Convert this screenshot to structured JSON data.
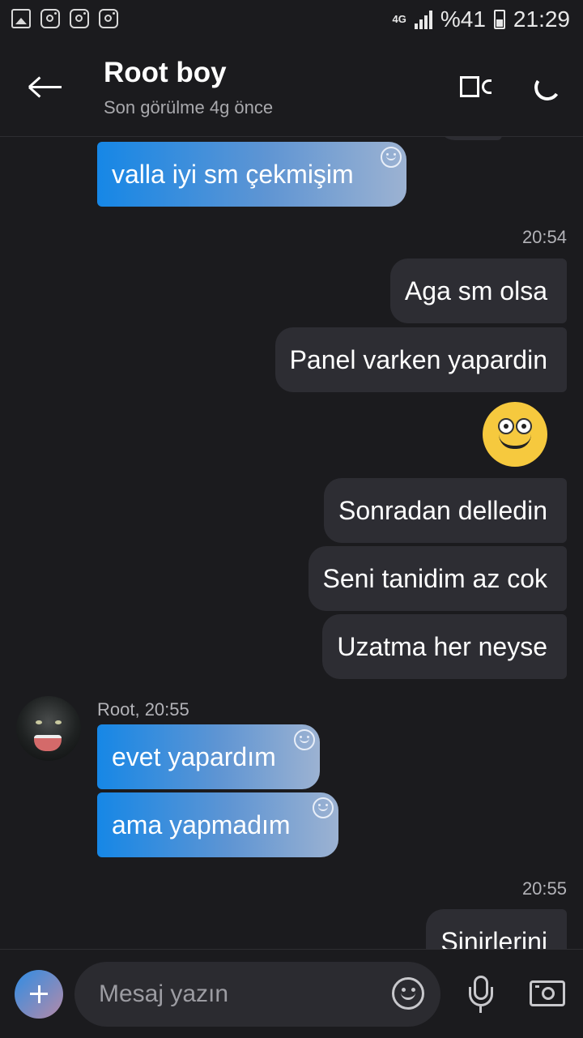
{
  "status_bar": {
    "net": "4G",
    "battery": "%41",
    "clock": "21:29",
    "icons": [
      "gallery-icon",
      "instagram-icon",
      "instagram-icon",
      "instagram-icon"
    ]
  },
  "header": {
    "title": "Root boy",
    "subtitle": "Son görülme 4g önce"
  },
  "messages": {
    "m1": "valla iyi sm çekmişim",
    "t1": "20:54",
    "m2": "Aga sm olsa",
    "m3": "Panel varken yapardin",
    "m4": "Sonradan delledin",
    "m5": "Seni tanidim az cok",
    "m6": "Uzatma her neyse",
    "sender": "Root, 20:55",
    "m7": "evet yapardım",
    "m8": "ama yapmadım",
    "t2": "20:55",
    "m9": "Sinirlerini"
  },
  "composer": {
    "placeholder": "Mesaj yazın"
  },
  "colors": {
    "background": "#1b1b1e",
    "incoming_start": "#1687e6",
    "incoming_end": "#9cb2d2",
    "outgoing": "#2d2d33"
  }
}
